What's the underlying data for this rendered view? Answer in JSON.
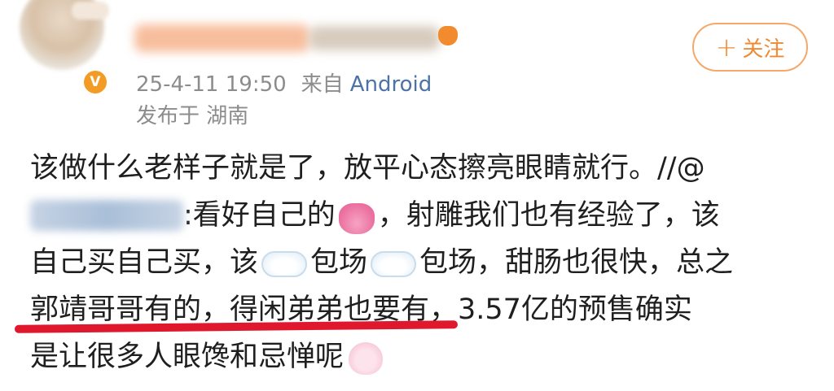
{
  "header": {
    "timestamp": "25-4-11 19:50",
    "source_prefix": "来自",
    "device": "Android",
    "location": "发布于 湖南",
    "verified_badge": "V",
    "follow_label": "关注",
    "follow_plus": "+"
  },
  "content": {
    "line1_text": "该做什么老样子就是了，放平心态擦亮眼睛就行。//@",
    "line2_text": ":看好自己的",
    "line2_tail": "，射雕我们也有经验了，该",
    "line3_a": "自己买自己买，该",
    "line3_b": "包场",
    "line3_c": "包场，甜肠也很快，总之",
    "line4_text": "郭靖哥哥有的，得闲弟弟也要有，3.57亿的预售确实",
    "line5_text": "是让很多人眼馋和忌惮呢"
  },
  "colors": {
    "link": "#4b73a6",
    "follow_accent": "#f08a32",
    "verified": "#f39c25",
    "underline": "#e0182d"
  },
  "icons": [
    "verified-icon",
    "fox-icon",
    "purse-emoji",
    "cloud-emoji",
    "rabbit-emoji"
  ]
}
